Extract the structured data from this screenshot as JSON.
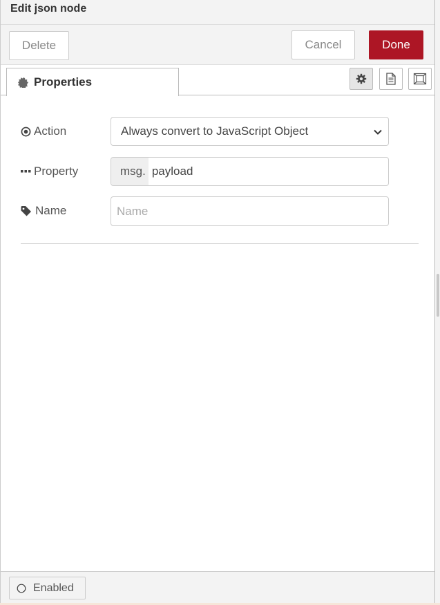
{
  "header": {
    "title": "Edit json node"
  },
  "toolbar": {
    "delete_label": "Delete",
    "cancel_label": "Cancel",
    "done_label": "Done",
    "done_color": "#ad1625"
  },
  "tabs": [
    {
      "label": "Properties",
      "icon": "gear-icon"
    }
  ],
  "tab_buttons": [
    {
      "icon": "gear-icon",
      "active": true
    },
    {
      "icon": "document-icon",
      "active": false
    },
    {
      "icon": "appearance-icon",
      "active": false
    }
  ],
  "form": {
    "action": {
      "label": "Action",
      "icon": "dot-circle-icon",
      "value": "Always convert to JavaScript Object"
    },
    "property": {
      "label": "Property",
      "icon": "ellipsis-icon",
      "prefix": "msg.",
      "value": "payload"
    },
    "name": {
      "label": "Name",
      "icon": "tag-icon",
      "placeholder": "Name",
      "value": ""
    }
  },
  "footer": {
    "enabled_label": "Enabled",
    "icon": "circle-outline-icon"
  }
}
